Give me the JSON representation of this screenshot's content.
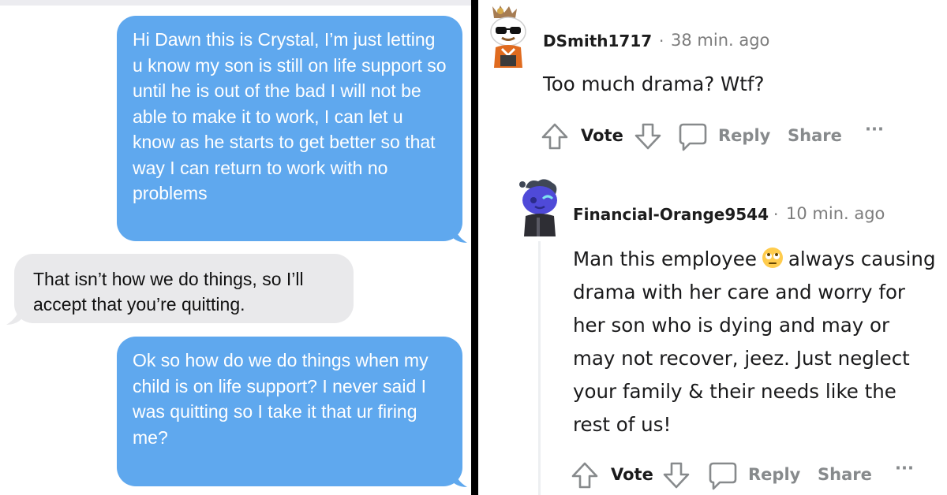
{
  "messages": [
    {
      "type": "sent",
      "text": "Hi Dawn this is Crystal, I’m just letting u know my son is still on life support so until he is out of the bad I will not be able to make it to work, I can let u know as he starts to get better so that way I can return to work with no problems"
    },
    {
      "type": "received",
      "text": "That isn’t how we do things, so I’ll accept that you’re quitting."
    },
    {
      "type": "sent",
      "text": "Ok so how do we do things when my child is on life support? I never said I was quitting so I take it that ur firing me?"
    }
  ],
  "comments": [
    {
      "username": "DSmith1717",
      "separator": "·",
      "time": "38 min. ago",
      "body": "Too much drama? Wtf?",
      "actions": {
        "vote": "Vote",
        "reply": "Reply",
        "share": "Share",
        "more": "···"
      }
    },
    {
      "username": "Financial-Orange9544",
      "separator": "·",
      "time": "10 min. ago",
      "body_before_emoji": "Man this employee",
      "emoji": "rolling-eyes-emoji",
      "body_after_emoji": "always causing drama with her care and worry for her son who is dying and may or may not recover, jeez. Just neglect your family & their needs like the rest of us!",
      "actions": {
        "vote": "Vote",
        "reply": "Reply",
        "share": "Share",
        "more": "···"
      }
    }
  ],
  "colors": {
    "sent_bubble": "#5fa8ee",
    "received_bubble": "#e9e9eb",
    "divider": "#000000",
    "meta_gray": "#7c7c7c",
    "action_gray": "#878a8c"
  }
}
